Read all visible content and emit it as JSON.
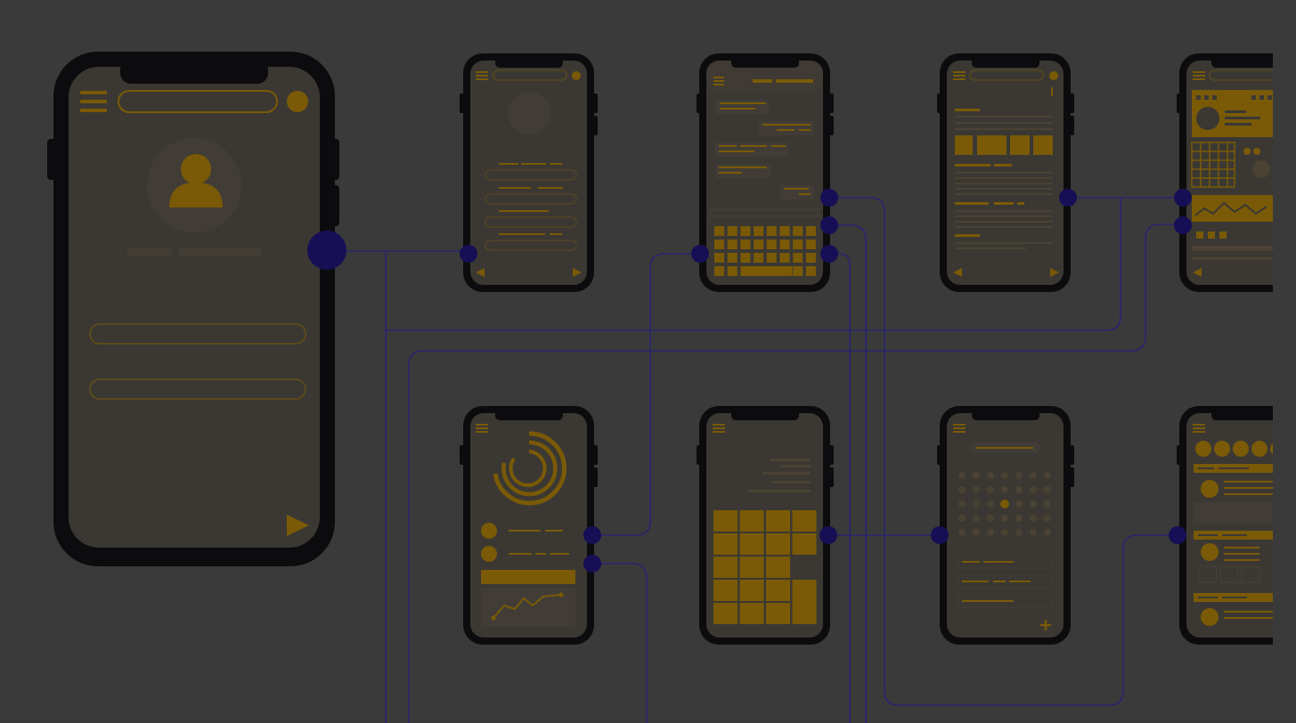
{
  "palette": {
    "background": "#3a3a3a",
    "phone_frame": "#0c0c0e",
    "screen": "#3b3833",
    "screen_alt": "#3f3a33",
    "accent": "#7a5a06",
    "accent_light": "#5c4a1c",
    "connector": "#2a2470",
    "node": "#170f55"
  },
  "screens": [
    {
      "id": "profile-main",
      "content": "profile",
      "icons": [
        "menu-icon",
        "search-bar",
        "avatar-icon",
        "user-silhouette-icon",
        "play-icon"
      ]
    },
    {
      "id": "login-form",
      "content": "form",
      "icons": [
        "menu-icon",
        "prev-arrow-icon",
        "next-arrow-icon"
      ]
    },
    {
      "id": "chat-keyboard",
      "content": "chat",
      "icons": [
        "menu-icon",
        "keyboard-icon"
      ]
    },
    {
      "id": "article",
      "content": "article",
      "icons": [
        "menu-icon",
        "prev-arrow-icon",
        "next-arrow-icon"
      ]
    },
    {
      "id": "dashboard",
      "content": "dashboard",
      "icons": [
        "menu-icon",
        "calendar-grid-icon",
        "line-chart-icon"
      ]
    },
    {
      "id": "analytics",
      "content": "analytics",
      "icons": [
        "menu-icon",
        "ring-chart-icon",
        "line-chart-icon"
      ]
    },
    {
      "id": "gallery-grid",
      "content": "grid",
      "icons": [
        "menu-icon"
      ]
    },
    {
      "id": "calendar",
      "content": "calendar",
      "icons": [
        "menu-icon",
        "add-icon"
      ]
    },
    {
      "id": "social-feed",
      "content": "feed",
      "icons": [
        "menu-icon"
      ]
    }
  ]
}
